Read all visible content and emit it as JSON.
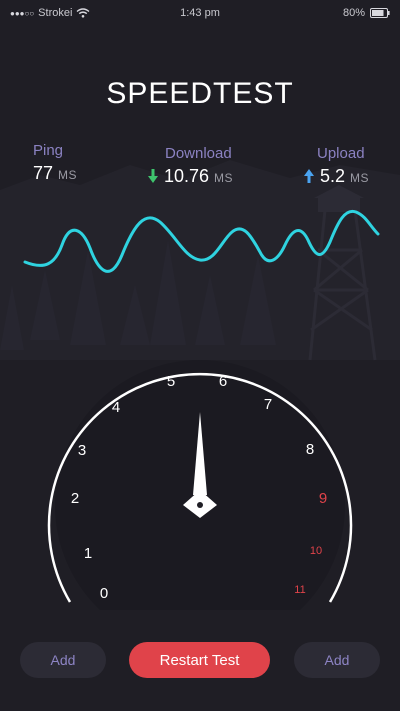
{
  "status_bar": {
    "carrier": "Strokei",
    "time": "1:43 pm",
    "battery": "80%",
    "signal_icon": "signal-dots-icon",
    "wifi_icon": "wifi-icon",
    "battery_icon": "battery-icon"
  },
  "header": {
    "title": "SPEEDTEST"
  },
  "stats": {
    "ping": {
      "label": "Ping",
      "value": "77",
      "unit": "MS"
    },
    "download": {
      "label": "Download",
      "value": "10.76",
      "unit": "MS",
      "icon": "arrow-down-icon",
      "icon_color": "#3ec46d"
    },
    "upload": {
      "label": "Upload",
      "value": "5.2",
      "unit": "MS",
      "icon": "arrow-up-icon",
      "icon_color": "#4aa3f0"
    }
  },
  "gauge": {
    "ticks": [
      "0",
      "1",
      "2",
      "3",
      "4",
      "5",
      "6",
      "7",
      "8",
      "9",
      "10",
      "11"
    ],
    "tick_colors": [
      "#ffffff",
      "#ffffff",
      "#ffffff",
      "#ffffff",
      "#ffffff",
      "#ffffff",
      "#ffffff",
      "#ffffff",
      "#ffffff",
      "#e0434a",
      "#e0434a",
      "#e0434a"
    ],
    "needle_value": 5.6,
    "max_value": 11
  },
  "buttons": {
    "add_left": "Add",
    "restart": "Restart Test",
    "add_right": "Add"
  },
  "colors": {
    "background": "#1f1e25",
    "wave": "#2fd3e0",
    "accent": "#e0434a",
    "label": "#8b82c2"
  }
}
